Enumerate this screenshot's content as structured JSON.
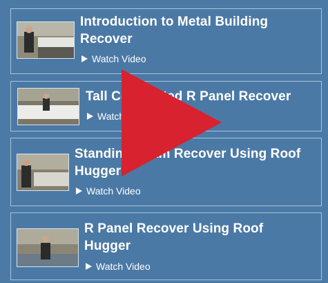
{
  "videos": [
    {
      "title_line1": "Introduction to Metal Building",
      "title_line2": "Recover",
      "watch_label": "Watch Video",
      "icon": "play-triangle-icon"
    },
    {
      "title_line1": "Tall Corrugated R Panel Recover",
      "title_line2": "",
      "watch_label": "Watch Video",
      "icon": "play-triangle-icon"
    },
    {
      "title_line1": "Standing Seam Recover Using Roof",
      "title_line2": "Hugger",
      "watch_label": "Watch Video",
      "icon": "play-triangle-icon"
    },
    {
      "title_line1": "R Panel Recover Using Roof",
      "title_line2": "Hugger",
      "watch_label": "Watch Video",
      "icon": "play-triangle-icon"
    }
  ],
  "colors": {
    "background": "#4b7aa7",
    "card_border": "#a9c3dc",
    "text": "#ffffff",
    "play_button": "#d8222f"
  },
  "overlay": {
    "icon": "large-play-button-icon"
  }
}
